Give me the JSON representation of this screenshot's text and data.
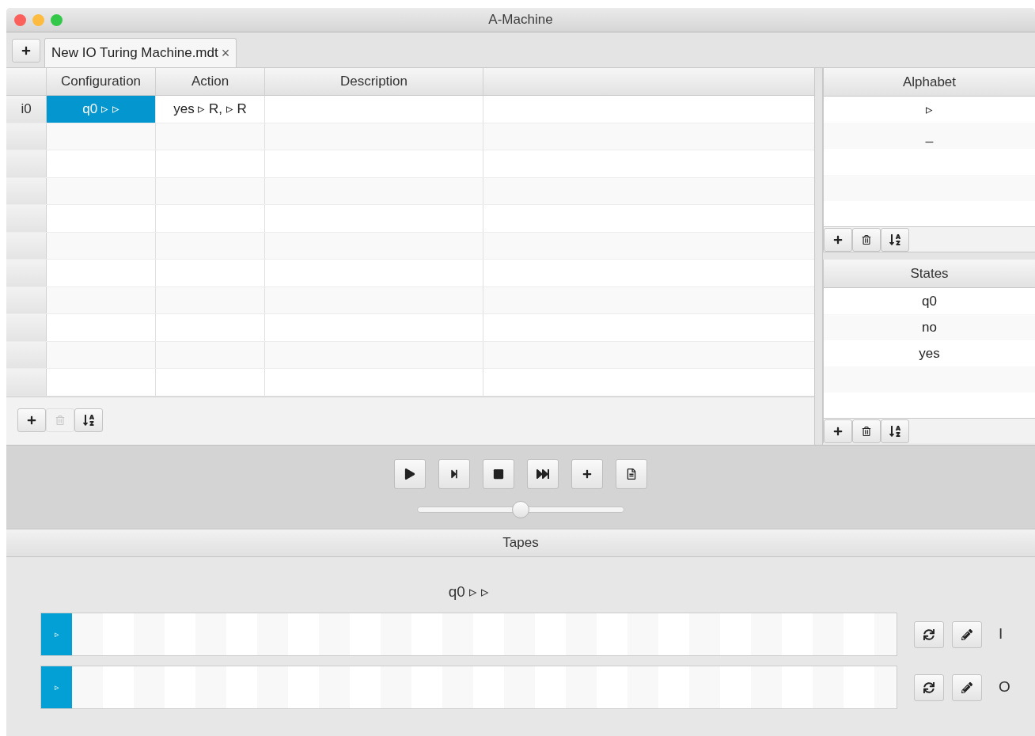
{
  "window": {
    "title": "A-Machine"
  },
  "tabs": [
    {
      "label": "New IO Turing Machine.mdt",
      "selected": true,
      "close": "×"
    }
  ],
  "table": {
    "columns": [
      "Configuration",
      "Action",
      "Description"
    ],
    "rows": [
      {
        "label": "i0",
        "configuration": "q0 ▹ ▹",
        "action": "yes ▹ R, ▹ R",
        "selected": true
      }
    ],
    "toolbar": [
      {
        "kind": "add",
        "disabled": false
      },
      {
        "kind": "delete",
        "disabled": true
      },
      {
        "kind": "sort",
        "disabled": false
      }
    ]
  },
  "alphabet": {
    "title": "Alphabet",
    "items": [
      "▹",
      "_"
    ],
    "toolbar": [
      {
        "kind": "add",
        "disabled": false
      },
      {
        "kind": "delete",
        "disabled": false
      },
      {
        "kind": "sort",
        "disabled": false
      }
    ]
  },
  "states": {
    "title": "States",
    "items": [
      "q0",
      "no",
      "yes"
    ],
    "toolbar": [
      {
        "kind": "add",
        "disabled": false
      },
      {
        "kind": "delete",
        "disabled": false
      },
      {
        "kind": "sort",
        "disabled": false
      }
    ]
  },
  "controls": {
    "buttons": [
      {
        "kind": "play"
      },
      {
        "kind": "step"
      },
      {
        "kind": "stop"
      },
      {
        "kind": "run"
      },
      {
        "kind": "add"
      },
      {
        "kind": "document"
      }
    ],
    "speed": {
      "level": 0.5
    }
  },
  "tapes": {
    "title": "Tapes",
    "state": "q0 ▹ ▹",
    "items": [
      {
        "label": "I",
        "cells": [
          {
            "symbol": "▹",
            "selected": true
          }
        ]
      },
      {
        "label": "O",
        "cells": [
          {
            "symbol": "▹",
            "selected": true
          }
        ]
      }
    ]
  }
}
